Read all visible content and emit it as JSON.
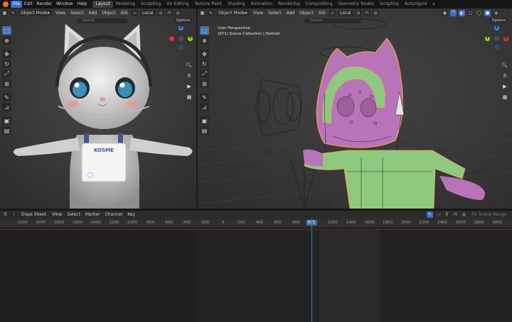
{
  "topbar": {
    "menus": [
      "File",
      "Edit",
      "Render",
      "Window",
      "Help"
    ],
    "workspaces": [
      "Layout",
      "Modeling",
      "Sculpting",
      "UV Editing",
      "Texture Paint",
      "Shading",
      "Animation",
      "Rendering",
      "Compositing",
      "Geometry Nodes",
      "Scripting",
      "Autorigpro"
    ],
    "active_workspace": "Layout",
    "plus_label": "+"
  },
  "left_viewport": {
    "mode": "Object Mode",
    "menus": [
      "View",
      "Select",
      "Add",
      "Object",
      "GIS"
    ],
    "transform_orientation": "Local",
    "search_placeholder": "Search",
    "options_label": "Options"
  },
  "right_viewport": {
    "mode": "Object Mode",
    "menus": [
      "View",
      "Select",
      "Add",
      "Object",
      "GIS"
    ],
    "transform_orientation": "Local",
    "search_placeholder": "Search",
    "options_label": "Options",
    "view_name": "User Perspective",
    "collection_info": "(971) Scene Collection | Helmet"
  },
  "dope_sheet": {
    "editor_label": "Dope Sheet",
    "menus": [
      "View",
      "Select",
      "Marker",
      "Channel",
      "Key"
    ],
    "search_placeholder": "Fix Scene Range",
    "current_frame": "971",
    "frame_ticks": [
      "-2200",
      "-2000",
      "-1800",
      "-1600",
      "-1400",
      "-1200",
      "-1000",
      "-800",
      "-600",
      "-400",
      "-200",
      "0",
      "200",
      "400",
      "600",
      "800",
      "1200",
      "1400",
      "1600",
      "1800",
      "2000",
      "2200",
      "2400",
      "2600",
      "2800",
      "3000"
    ]
  },
  "colors": {
    "accent": "#4772b3",
    "blender_orange": "#e87d0d",
    "axis_x": "#e0334a",
    "axis_y": "#8bdc00",
    "axis_z": "#2d8ceb",
    "selected_outline": "#f5a83a",
    "suit_green": "#8fc87f",
    "char_pink": "#b874b8"
  }
}
